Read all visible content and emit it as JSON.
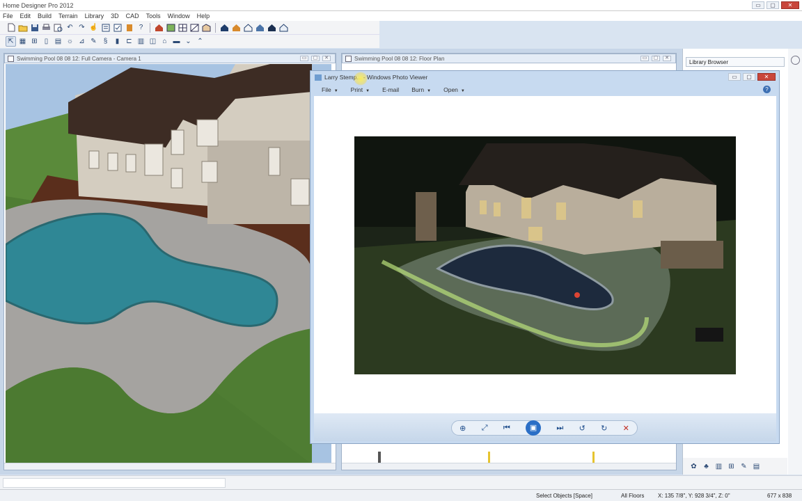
{
  "app": {
    "title": "Home Designer Pro 2012",
    "menus": [
      "File",
      "Edit",
      "Build",
      "Terrain",
      "Library",
      "3D",
      "CAD",
      "Tools",
      "Window",
      "Help"
    ]
  },
  "views": {
    "camera_title": "Swimming Pool 08 08 12: Full Camera - Camera 1",
    "floorplan_title": "Swimming Pool 08 08 12: Floor Plan",
    "library_title": "Library Browser"
  },
  "photo_viewer": {
    "title": "Larry Stemp... - Windows Photo Viewer",
    "menus": [
      "File",
      "Print",
      "E-mail",
      "Burn",
      "Open"
    ],
    "controls": {
      "zoom": "⊕",
      "fit": "⤢",
      "previous": "⏮",
      "slideshow": "▣",
      "next": "⏭",
      "rotate_ccw": "↺",
      "rotate_cw": "↻",
      "delete": "✕"
    }
  },
  "status": {
    "hint": "Select Objects [Space]",
    "floors": "All Floors",
    "coords": "X: 135 7/8\", Y: 928 3/4\", Z: 0\"",
    "size": "677 x 838"
  },
  "icons": {
    "minimize": "▭",
    "maximize": "▢",
    "close": "✕"
  }
}
